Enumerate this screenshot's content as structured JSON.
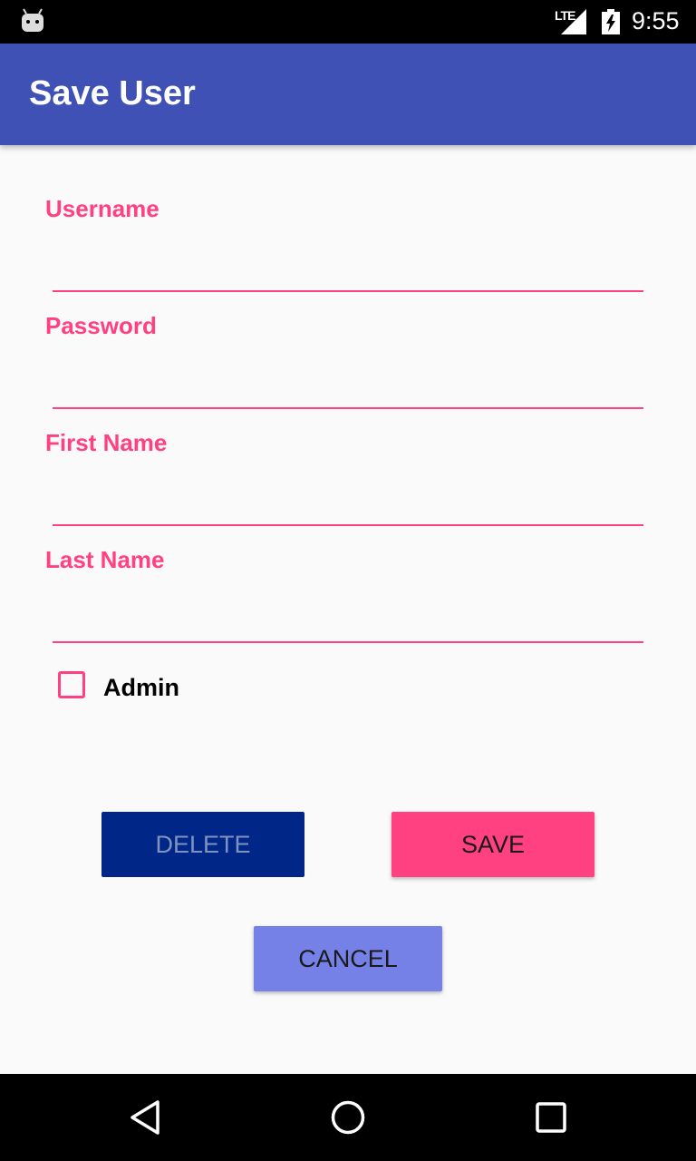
{
  "status_bar": {
    "network": "LTE",
    "time": "9:55",
    "icons": [
      "android-icon",
      "signal-icon",
      "battery-icon"
    ]
  },
  "app_bar": {
    "title": "Save User"
  },
  "form": {
    "fields": [
      {
        "label": "Username",
        "value": ""
      },
      {
        "label": "Password",
        "value": ""
      },
      {
        "label": "First Name",
        "value": ""
      },
      {
        "label": "Last Name",
        "value": ""
      }
    ],
    "admin_checkbox": {
      "label": "Admin",
      "checked": false
    }
  },
  "buttons": {
    "delete": "DELETE",
    "save": "SAVE",
    "cancel": "CANCEL"
  },
  "nav_bar": {
    "icons": [
      "back-icon",
      "home-icon",
      "recents-icon"
    ]
  },
  "colors": {
    "app_bar": "#3f51b5",
    "accent": "#ff4081",
    "delete_button": "#002787",
    "cancel_button": "#7681e8"
  }
}
